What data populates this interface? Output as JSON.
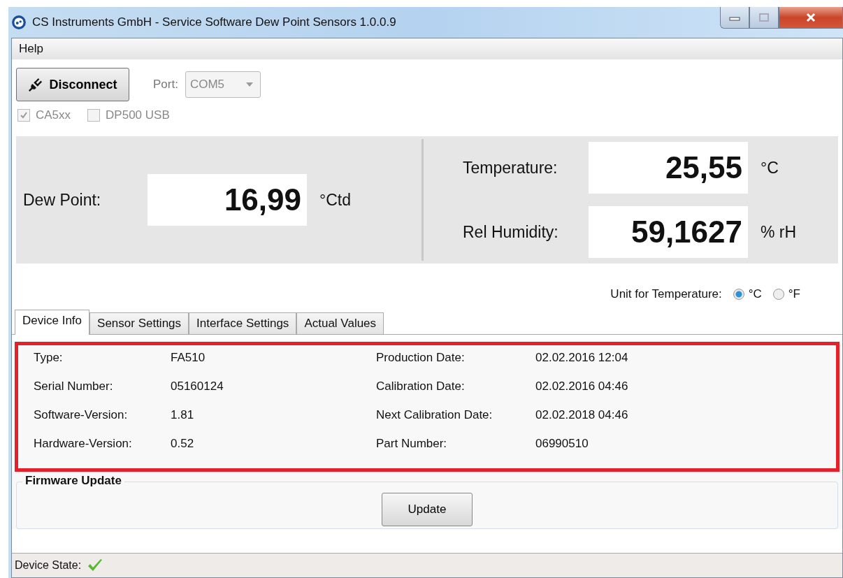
{
  "window": {
    "title": "CS Instruments GmbH - Service Software Dew Point Sensors  1.0.0.9"
  },
  "menu": [
    {
      "label": "Help"
    }
  ],
  "connection": {
    "button": "Disconnect",
    "port_label": "Port:",
    "port_value": "COM5",
    "port_disabled": true
  },
  "device_types": [
    {
      "label": "CA5xx",
      "checked": true,
      "disabled": true
    },
    {
      "label": "DP500 USB",
      "checked": false,
      "disabled": true
    }
  ],
  "main_reading": {
    "label": "Dew Point:",
    "value": "16,99",
    "unit": "°Ctd"
  },
  "side_readings": [
    {
      "label": "Temperature:",
      "value": "25,55",
      "unit": "°C"
    },
    {
      "label": "Rel Humidity:",
      "value": "59,1627",
      "unit": "% rH"
    }
  ],
  "unit_selector": {
    "label": "Unit for Temperature:",
    "options": [
      {
        "label": "°C",
        "selected": true
      },
      {
        "label": "°F",
        "selected": false
      }
    ]
  },
  "tabs": [
    {
      "label": "Device Info",
      "selected": true
    },
    {
      "label": "Sensor Settings",
      "selected": false
    },
    {
      "label": "Interface Settings",
      "selected": false
    },
    {
      "label": "Actual Values",
      "selected": false
    }
  ],
  "device_info": {
    "highlighted": true,
    "columns": [
      [
        {
          "label": "Type:",
          "value": "FA510"
        },
        {
          "label": "Serial Number:",
          "value": "05160124"
        },
        {
          "label": "Software-Version:",
          "value": "1.81"
        },
        {
          "label": "Hardware-Version:",
          "value": "0.52"
        }
      ],
      [
        {
          "label": "Production Date:",
          "value": "02.02.2016 12:04"
        },
        {
          "label": "Calibration Date:",
          "value": "02.02.2016 04:46"
        },
        {
          "label": "Next Calibration Date:",
          "value": "02.02.2018 04:46"
        },
        {
          "label": "Part Number:",
          "value": "06990510"
        }
      ]
    ]
  },
  "firmware_update": {
    "title": "Firmware Update",
    "button": "Update"
  },
  "status_bar": {
    "label": "Device State:",
    "ok": true
  }
}
